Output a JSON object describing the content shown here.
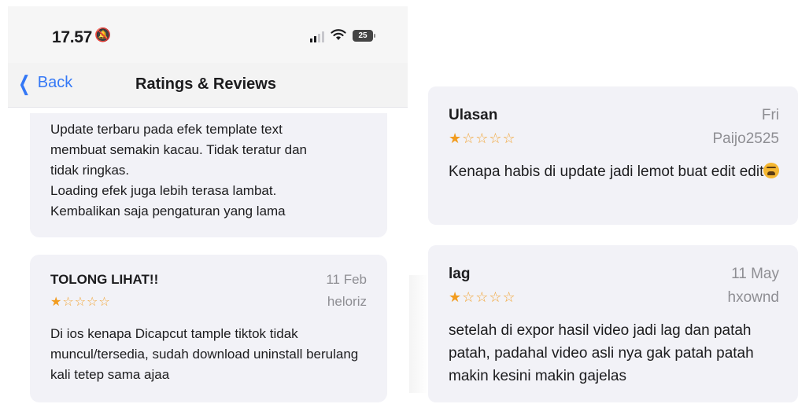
{
  "status_bar": {
    "time": "17.57",
    "battery": "25",
    "bell_icon": "bell-slash-icon",
    "wifi_icon": "wifi-icon",
    "signal_icon": "cellular-signal-icon"
  },
  "nav": {
    "back_label": "Back",
    "title": "Ratings & Reviews"
  },
  "reviews_left": [
    {
      "body": "Update terbaru pada efek template text\nmembuat semakin kacau. Tidak teratur dan\ntidak ringkas.\nLoading efek juga lebih terasa lambat.\nKembalikan saja pengaturan yang lama"
    },
    {
      "title": "TOLONG LIHAT!!",
      "date": "11 Feb",
      "stars": 1,
      "author": "heloriz",
      "body": "Di ios kenapa Dicapcut tample tiktok tidak muncul/tersedia, sudah download uninstall berulang kali tetep sama ajaa"
    }
  ],
  "reviews_right": [
    {
      "title": "Ulasan",
      "date": "Fri",
      "stars": 1,
      "author": "Paijo2525",
      "body": "Kenapa habis di update jadi lemot buat edit edit",
      "emoji": "tired-face-emoji"
    },
    {
      "title": "lag",
      "date": "11 May",
      "stars": 1,
      "author": "hxownd",
      "body": "setelah di expor hasil video jadi lag dan patah patah, padahal video asli nya gak patah patah makin kesini makin gajelas"
    }
  ],
  "colors": {
    "accent": "#3478f6",
    "star": "#f29c1f",
    "card_bg": "#f2f2f7",
    "secondary_text": "#8e8e93"
  }
}
